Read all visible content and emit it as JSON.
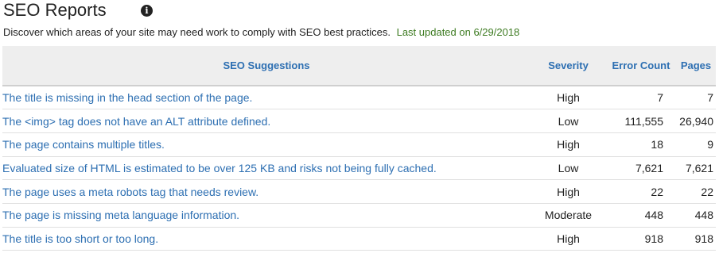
{
  "page": {
    "title": "SEO Reports",
    "info_icon": "info-circle-icon",
    "description": "Discover which areas of your site may need work to comply with SEO best practices.",
    "last_updated": "Last updated on 6/29/2018",
    "colors": {
      "link": "#2d6fb2",
      "updated": "#3d7b21",
      "header_bg": "#eeeeee"
    }
  },
  "table": {
    "headers": {
      "suggestion": "SEO Suggestions",
      "severity": "Severity",
      "error_count": "Error Count",
      "pages": "Pages"
    },
    "rows": [
      {
        "suggestion": "The title is missing in the head section of the page.",
        "severity": "High",
        "error_count": "7",
        "pages": "7"
      },
      {
        "suggestion": "The <img> tag does not have an ALT attribute defined.",
        "severity": "Low",
        "error_count": "111,555",
        "pages": "26,940"
      },
      {
        "suggestion": "The page contains multiple titles.",
        "severity": "High",
        "error_count": "18",
        "pages": "9"
      },
      {
        "suggestion": "Evaluated size of HTML is estimated to be over 125 KB and risks not being fully cached.",
        "severity": "Low",
        "error_count": "7,621",
        "pages": "7,621"
      },
      {
        "suggestion": "The page uses a meta robots tag that needs review.",
        "severity": "High",
        "error_count": "22",
        "pages": "22"
      },
      {
        "suggestion": "The page is missing meta language information.",
        "severity": "Moderate",
        "error_count": "448",
        "pages": "448"
      },
      {
        "suggestion": "The title is too short or too long.",
        "severity": "High",
        "error_count": "918",
        "pages": "918"
      }
    ]
  }
}
